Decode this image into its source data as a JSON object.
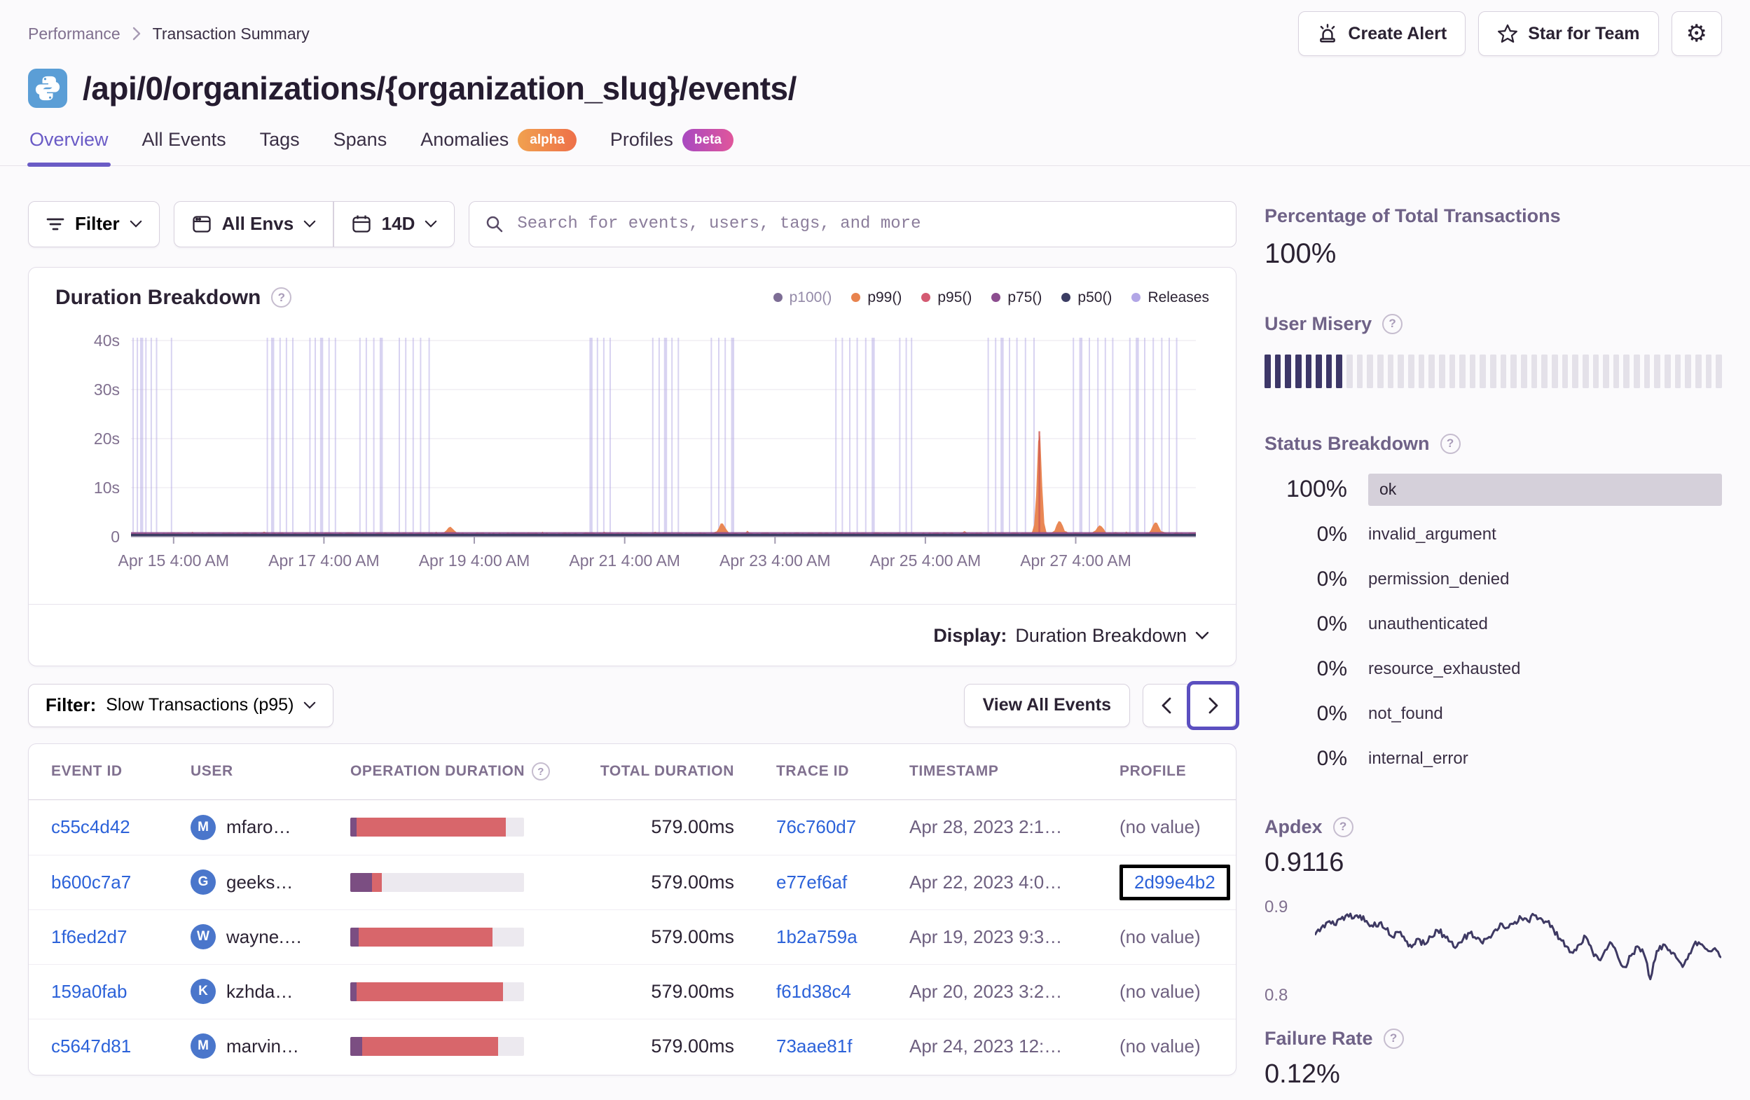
{
  "colors": {
    "accent": "#6a5bc6",
    "link": "#2c62d9",
    "legend": {
      "p100": "#7d6d95",
      "p99": "#e8834e",
      "p95": "#d45a72",
      "p75": "#8c4d8f",
      "p50": "#3b3d63",
      "releases": "#b2a6e6"
    },
    "op_bar_purple": "#7b4e82",
    "op_bar_red": "#d8666b",
    "release_line": "#b3a8e4",
    "area_orange": "#e8824d",
    "misery_filled": "#3d3768",
    "sparkline": "#3e3963",
    "ok_bar_bg": "#d5d0da",
    "avatar_bg": "#4a76cb",
    "python_tile": "#5b9ed6"
  },
  "breadcrumb": {
    "performance": "Performance",
    "current": "Transaction Summary"
  },
  "header": {
    "title": "/api/0/organizations/{organization_slug}/events/",
    "create_alert": "Create Alert",
    "star_for_team": "Star for Team"
  },
  "tabs": [
    {
      "label": "Overview",
      "active": true
    },
    {
      "label": "All Events"
    },
    {
      "label": "Tags"
    },
    {
      "label": "Spans"
    },
    {
      "label": "Anomalies",
      "badge": "alpha"
    },
    {
      "label": "Profiles",
      "badge": "beta"
    }
  ],
  "filter_bar": {
    "filter_label": "Filter",
    "envs_label": "All Envs",
    "date_label": "14D",
    "search_placeholder": "Search for events, users, tags, and more"
  },
  "duration_card": {
    "title": "Duration Breakdown",
    "display_label": "Display:",
    "display_value": "Duration Breakdown"
  },
  "legend_items": [
    {
      "label": "p100()",
      "color_key": "p100",
      "muted": true
    },
    {
      "label": "p99()",
      "color_key": "p99"
    },
    {
      "label": "p95()",
      "color_key": "p95"
    },
    {
      "label": "p75()",
      "color_key": "p75"
    },
    {
      "label": "p50()",
      "color_key": "p50"
    },
    {
      "label": "Releases",
      "color_key": "releases"
    }
  ],
  "list_controls": {
    "filter_label": "Filter:",
    "filter_value": "Slow Transactions (p95)",
    "view_all": "View All Events"
  },
  "table": {
    "columns": [
      "EVENT ID",
      "USER",
      "OPERATION DURATION",
      "TOTAL DURATION",
      "TRACE ID",
      "TIMESTAMP",
      "PROFILE"
    ],
    "rows": [
      {
        "event_id": "c55c4d42",
        "user_initial": "M",
        "user": "mfaro…",
        "op_purple": 0.035,
        "op_red": 0.86,
        "total": "579.00ms",
        "trace_id": "76c760d7",
        "timestamp": "Apr 28, 2023 2:1…",
        "profile": "(no value)"
      },
      {
        "event_id": "b600c7a7",
        "user_initial": "G",
        "user": "geeks…",
        "op_purple": 0.125,
        "op_red": 0.055,
        "total": "579.00ms",
        "trace_id": "e77ef6af",
        "timestamp": "Apr 22, 2023 4:0…",
        "profile": "2d99e4b2",
        "profile_link": true
      },
      {
        "event_id": "1f6ed2d7",
        "user_initial": "W",
        "user": "wayne.…",
        "op_purple": 0.048,
        "op_red": 0.77,
        "total": "579.00ms",
        "trace_id": "1b2a759a",
        "timestamp": "Apr 19, 2023 9:3…",
        "profile": "(no value)"
      },
      {
        "event_id": "159a0fab",
        "user_initial": "K",
        "user": "kzhda…",
        "op_purple": 0.035,
        "op_red": 0.845,
        "total": "579.00ms",
        "trace_id": "f61d38c4",
        "timestamp": "Apr 20, 2023 3:2…",
        "profile": "(no value)"
      },
      {
        "event_id": "c5647d81",
        "user_initial": "M",
        "user": "marvin…",
        "op_purple": 0.07,
        "op_red": 0.78,
        "total": "579.00ms",
        "trace_id": "73aae81f",
        "timestamp": "Apr 24, 2023 12:…",
        "profile": "(no value)"
      }
    ]
  },
  "sidebar": {
    "pct_total": {
      "title": "Percentage of Total Transactions",
      "value": "100%"
    },
    "user_misery": {
      "title": "User Misery"
    },
    "status_breakdown": {
      "title": "Status Breakdown",
      "rows": [
        {
          "pct": "100%",
          "label": "ok",
          "bar": true
        },
        {
          "pct": "0%",
          "label": "invalid_argument"
        },
        {
          "pct": "0%",
          "label": "permission_denied"
        },
        {
          "pct": "0%",
          "label": "unauthenticated"
        },
        {
          "pct": "0%",
          "label": "resource_exhausted"
        },
        {
          "pct": "0%",
          "label": "not_found"
        },
        {
          "pct": "0%",
          "label": "internal_error"
        }
      ]
    },
    "apdex": {
      "title": "Apdex",
      "value": "0.9116"
    },
    "failure_rate": {
      "title": "Failure Rate",
      "value": "0.12%"
    }
  },
  "chart_data": [
    {
      "type": "area",
      "title": "Duration Breakdown",
      "series_legend": [
        "p100()",
        "p99()",
        "p95()",
        "p75()",
        "p50()",
        "Releases"
      ],
      "hidden_series": [
        "p100()"
      ],
      "x_labels": [
        "Apr 15 4:00 AM",
        "Apr 17 4:00 AM",
        "Apr 19 4:00 AM",
        "Apr 21 4:00 AM",
        "Apr 23 4:00 AM",
        "Apr 25 4:00 AM",
        "Apr 27 4:00 AM"
      ],
      "x_label_start_frac": 0.04,
      "x_label_step_frac": 0.1412,
      "ylim": [
        0,
        40
      ],
      "y_ticks": [
        {
          "value": 0,
          "label": "0"
        },
        {
          "value": 10,
          "label": "10s"
        },
        {
          "value": 20,
          "label": "20s"
        },
        {
          "value": 30,
          "label": "30s"
        },
        {
          "value": 40,
          "label": "40s"
        }
      ],
      "p99_baseline_seconds": 0.8,
      "p99_spikes": [
        {
          "x": 0.3,
          "v": 1.4,
          "w": 0.004
        },
        {
          "x": 0.555,
          "v": 2.0,
          "w": 0.004
        },
        {
          "x": 0.853,
          "v": 21.5,
          "w": 0.003
        },
        {
          "x": 0.872,
          "v": 2.6,
          "w": 0.004
        },
        {
          "x": 0.91,
          "v": 1.8,
          "w": 0.004
        },
        {
          "x": 0.962,
          "v": 2.2,
          "w": 0.004
        }
      ],
      "release_lines": [
        0.002,
        0.006,
        0.01,
        0.014,
        0.019,
        0.024,
        0.038,
        0.128,
        0.133,
        0.14,
        0.146,
        0.152,
        0.168,
        0.173,
        0.179,
        0.186,
        0.192,
        0.215,
        0.221,
        0.228,
        0.235,
        0.252,
        0.258,
        0.265,
        0.272,
        0.28,
        0.432,
        0.438,
        0.444,
        0.45,
        0.49,
        0.496,
        0.502,
        0.508,
        0.514,
        0.545,
        0.552,
        0.558,
        0.565,
        0.662,
        0.668,
        0.675,
        0.682,
        0.69,
        0.697,
        0.722,
        0.728,
        0.733,
        0.805,
        0.812,
        0.818,
        0.825,
        0.832,
        0.84,
        0.848,
        0.885,
        0.892,
        0.9,
        0.908,
        0.915,
        0.922,
        0.938,
        0.945,
        0.952,
        0.96,
        0.968,
        0.975,
        0.982
      ]
    },
    {
      "type": "line",
      "title": "Apdex",
      "value": "0.9116",
      "ylim": [
        0.8,
        0.9
      ],
      "y_tick_labels": [
        "0.9",
        "0.8"
      ],
      "values": [
        0.863,
        0.871,
        0.877,
        0.874,
        0.88,
        0.885,
        0.881,
        0.884,
        0.878,
        0.872,
        0.876,
        0.869,
        0.861,
        0.866,
        0.857,
        0.85,
        0.859,
        0.853,
        0.861,
        0.868,
        0.863,
        0.856,
        0.851,
        0.859,
        0.865,
        0.859,
        0.854,
        0.861,
        0.869,
        0.875,
        0.871,
        0.877,
        0.881,
        0.878,
        0.884,
        0.881,
        0.877,
        0.869,
        0.859,
        0.851,
        0.844,
        0.853,
        0.861,
        0.846,
        0.837,
        0.847,
        0.854,
        0.839,
        0.829,
        0.841,
        0.851,
        0.843,
        0.816,
        0.846,
        0.853,
        0.847,
        0.839,
        0.829,
        0.843,
        0.856,
        0.853,
        0.846,
        0.849,
        0.839
      ]
    },
    {
      "type": "bar",
      "title": "User Misery",
      "bars_total": 45,
      "bars_filled": 8
    }
  ]
}
